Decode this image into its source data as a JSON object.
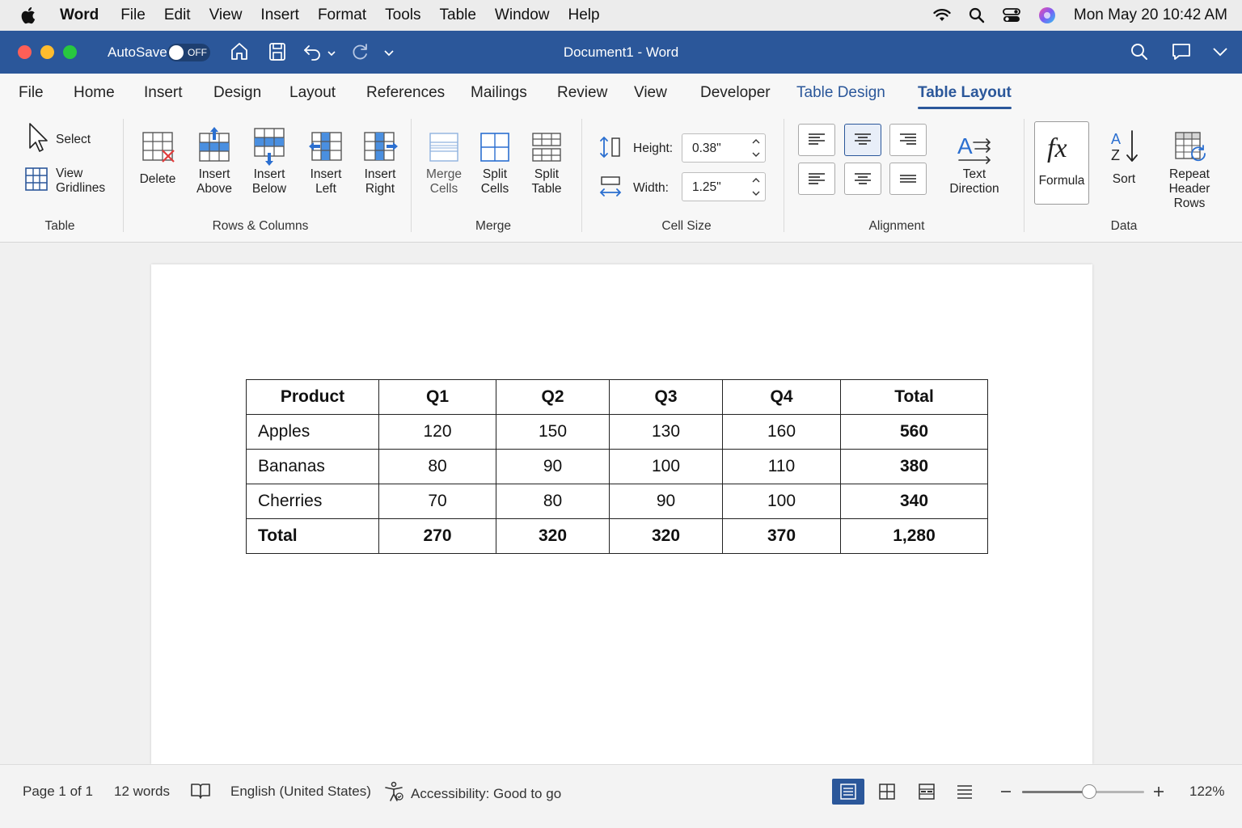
{
  "mac_menu": {
    "app_name": "Word",
    "items": [
      "File",
      "Edit",
      "View",
      "Insert",
      "Format",
      "Tools",
      "Table",
      "Window",
      "Help"
    ],
    "clock": "Mon May 20  10:42 AM"
  },
  "titlebar": {
    "autosave_label": "AutoSave",
    "autosave_state": "OFF",
    "doc_title": "Document1  -  Word"
  },
  "ribbon_tabs": [
    "File",
    "Home",
    "Insert",
    "Design",
    "Layout",
    "References",
    "Mailings",
    "Review",
    "View",
    "Developer",
    "Table Design",
    "Table Layout"
  ],
  "active_tab": "Table Layout",
  "ribbon": {
    "table_group": {
      "label": "Table",
      "select": "Select",
      "view_gridlines_1": "View",
      "view_gridlines_2": "Gridlines"
    },
    "rows_cols_group": {
      "label": "Rows & Columns",
      "delete": "Delete",
      "insert_above_1": "Insert",
      "insert_above_2": "Above",
      "insert_below_1": "Insert",
      "insert_below_2": "Below",
      "insert_left_1": "Insert",
      "insert_left_2": "Left",
      "insert_right_1": "Insert",
      "insert_right_2": "Right"
    },
    "merge_group": {
      "label": "Merge",
      "merge_1": "Merge",
      "merge_2": "Cells",
      "split_cells_1": "Split",
      "split_cells_2": "Cells",
      "split_table_1": "Split",
      "split_table_2": "Table"
    },
    "cell_size_group": {
      "label": "Cell Size",
      "height_label": "Height:",
      "height_value": "0.38\"",
      "width_label": "Width:",
      "width_value": "1.25\""
    },
    "alignment_group": {
      "label": "Alignment",
      "text_direction_1": "Text",
      "text_direction_2": "Direction"
    },
    "data_group": {
      "label": "Data",
      "formula": "Formula",
      "sort": "Sort",
      "repeat_1": "Repeat",
      "repeat_2": "Header Rows"
    }
  },
  "table": {
    "headers": [
      "Product",
      "Q1",
      "Q2",
      "Q3",
      "Q4",
      "Total"
    ],
    "rows": [
      [
        "Apples",
        "120",
        "150",
        "130",
        "160",
        "560"
      ],
      [
        "Bananas",
        "80",
        "90",
        "100",
        "110",
        "380"
      ],
      [
        "Cherries",
        "70",
        "80",
        "90",
        "100",
        "340"
      ],
      [
        "Total",
        "270",
        "320",
        "320",
        "370",
        "1,280"
      ]
    ]
  },
  "status": {
    "page": "Page 1 of 1",
    "words": "12 words",
    "language": "English (United States)",
    "accessibility": "Accessibility: Good to go",
    "zoom": "122%",
    "zoom_level": 0.55
  },
  "colors": {
    "accent": "#2b579a",
    "delete_red": "#e23b3b",
    "insert_blue": "#4a8fe0"
  }
}
